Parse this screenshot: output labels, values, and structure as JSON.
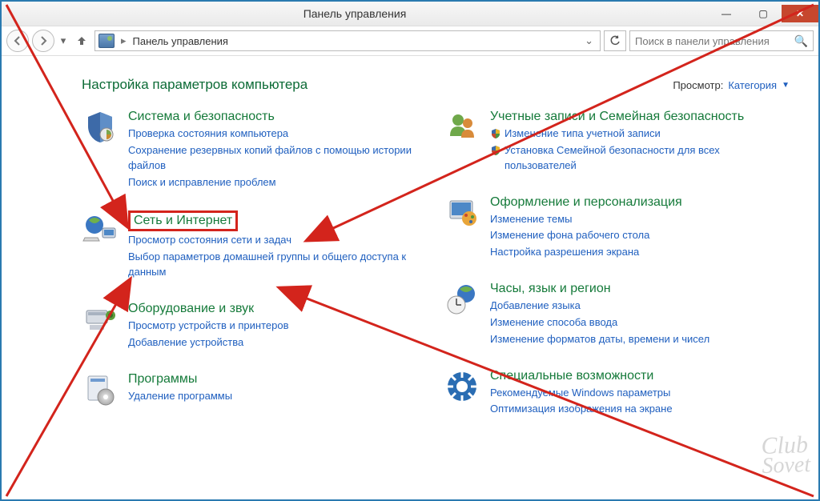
{
  "window": {
    "title": "Панель управления"
  },
  "nav": {
    "breadcrumb": "Панель управления",
    "search_placeholder": "Поиск в панели управления"
  },
  "heading": "Настройка параметров компьютера",
  "view_label": "Просмотр:",
  "view_value": "Категория",
  "categories_left": [
    {
      "title": "Система и безопасность",
      "links": [
        {
          "text": "Проверка состояния компьютера"
        },
        {
          "text": "Сохранение резервных копий файлов с помощью истории файлов"
        },
        {
          "text": "Поиск и исправление проблем"
        }
      ]
    },
    {
      "title": "Сеть и Интернет",
      "highlight": true,
      "links": [
        {
          "text": "Просмотр состояния сети и задач"
        },
        {
          "text": "Выбор параметров домашней группы и общего доступа к данным"
        }
      ]
    },
    {
      "title": "Оборудование и звук",
      "links": [
        {
          "text": "Просмотр устройств и принтеров"
        },
        {
          "text": "Добавление устройства"
        }
      ]
    },
    {
      "title": "Программы",
      "links": [
        {
          "text": "Удаление программы"
        }
      ]
    }
  ],
  "categories_right": [
    {
      "title": "Учетные записи и Семейная безопасность",
      "links": [
        {
          "text": "Изменение типа учетной записи",
          "shield": true
        },
        {
          "text": "Установка Семейной безопасности для всех пользователей",
          "shield": true
        }
      ]
    },
    {
      "title": "Оформление и персонализация",
      "links": [
        {
          "text": "Изменение темы"
        },
        {
          "text": "Изменение фона рабочего стола"
        },
        {
          "text": "Настройка разрешения экрана"
        }
      ]
    },
    {
      "title": "Часы, язык и регион",
      "links": [
        {
          "text": "Добавление языка"
        },
        {
          "text": "Изменение способа ввода"
        },
        {
          "text": "Изменение форматов даты, времени и чисел"
        }
      ]
    },
    {
      "title": "Специальные возможности",
      "links": [
        {
          "text": "Рекомендуемые Windows параметры"
        },
        {
          "text": "Оптимизация изображения на экране"
        }
      ]
    }
  ],
  "watermark": {
    "line1": "Club",
    "line2": "Sovet"
  }
}
